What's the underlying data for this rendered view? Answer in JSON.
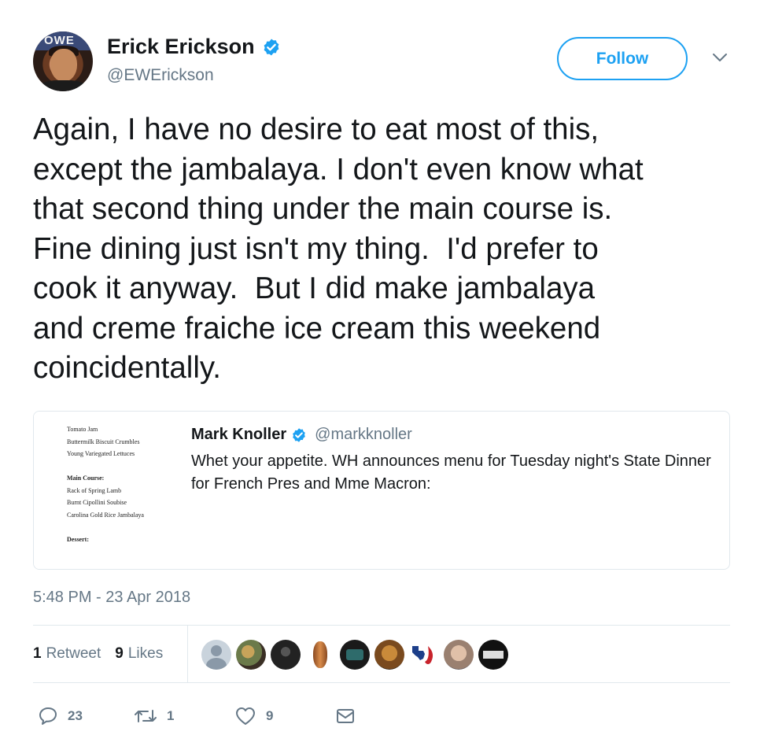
{
  "tweet": {
    "author": {
      "display_name": "Erick Erickson",
      "handle": "@EWErickson",
      "verified": true,
      "avatar_magazine_text": "OWE"
    },
    "follow_label": "Follow",
    "text_lines": [
      "Again, I have no desire to eat most of this,",
      "except the jambalaya. I don't even know what",
      "that second thing under the main course is.",
      "Fine dining just isn't my thing.  I'd prefer to",
      "cook it anyway.  But I did make jambalaya",
      "and creme fraiche ice cream this weekend",
      "coincidentally."
    ],
    "quoted": {
      "display_name": "Mark Knoller",
      "handle": "@markknoller",
      "verified": true,
      "text": "Whet your appetite. WH announces menu for Tuesday night's State Dinner for French Pres and Mme Macron:",
      "menu_image": {
        "line1": "Tomato Jam",
        "line2": "Buttermilk Biscuit Crumbles",
        "line3": "Young Variegated Lettuces",
        "line4": "Main Course:",
        "line5": "Rack of Spring Lamb",
        "line6": "Burnt Cipollini Soubise",
        "line7": "Carolina Gold Rice Jambalaya",
        "line8": "Dessert:"
      }
    },
    "timestamp": "5:48 PM - 23 Apr 2018",
    "stats": {
      "retweets_count": "1",
      "retweets_label": "Retweet",
      "likes_count": "9",
      "likes_label": "Likes"
    },
    "actions": {
      "replies": "23",
      "retweets": "1",
      "likes": "9"
    },
    "colors": {
      "accent": "#1da1f2",
      "text": "#14171a",
      "secondary": "#657786",
      "border": "#e1e8ed"
    }
  }
}
